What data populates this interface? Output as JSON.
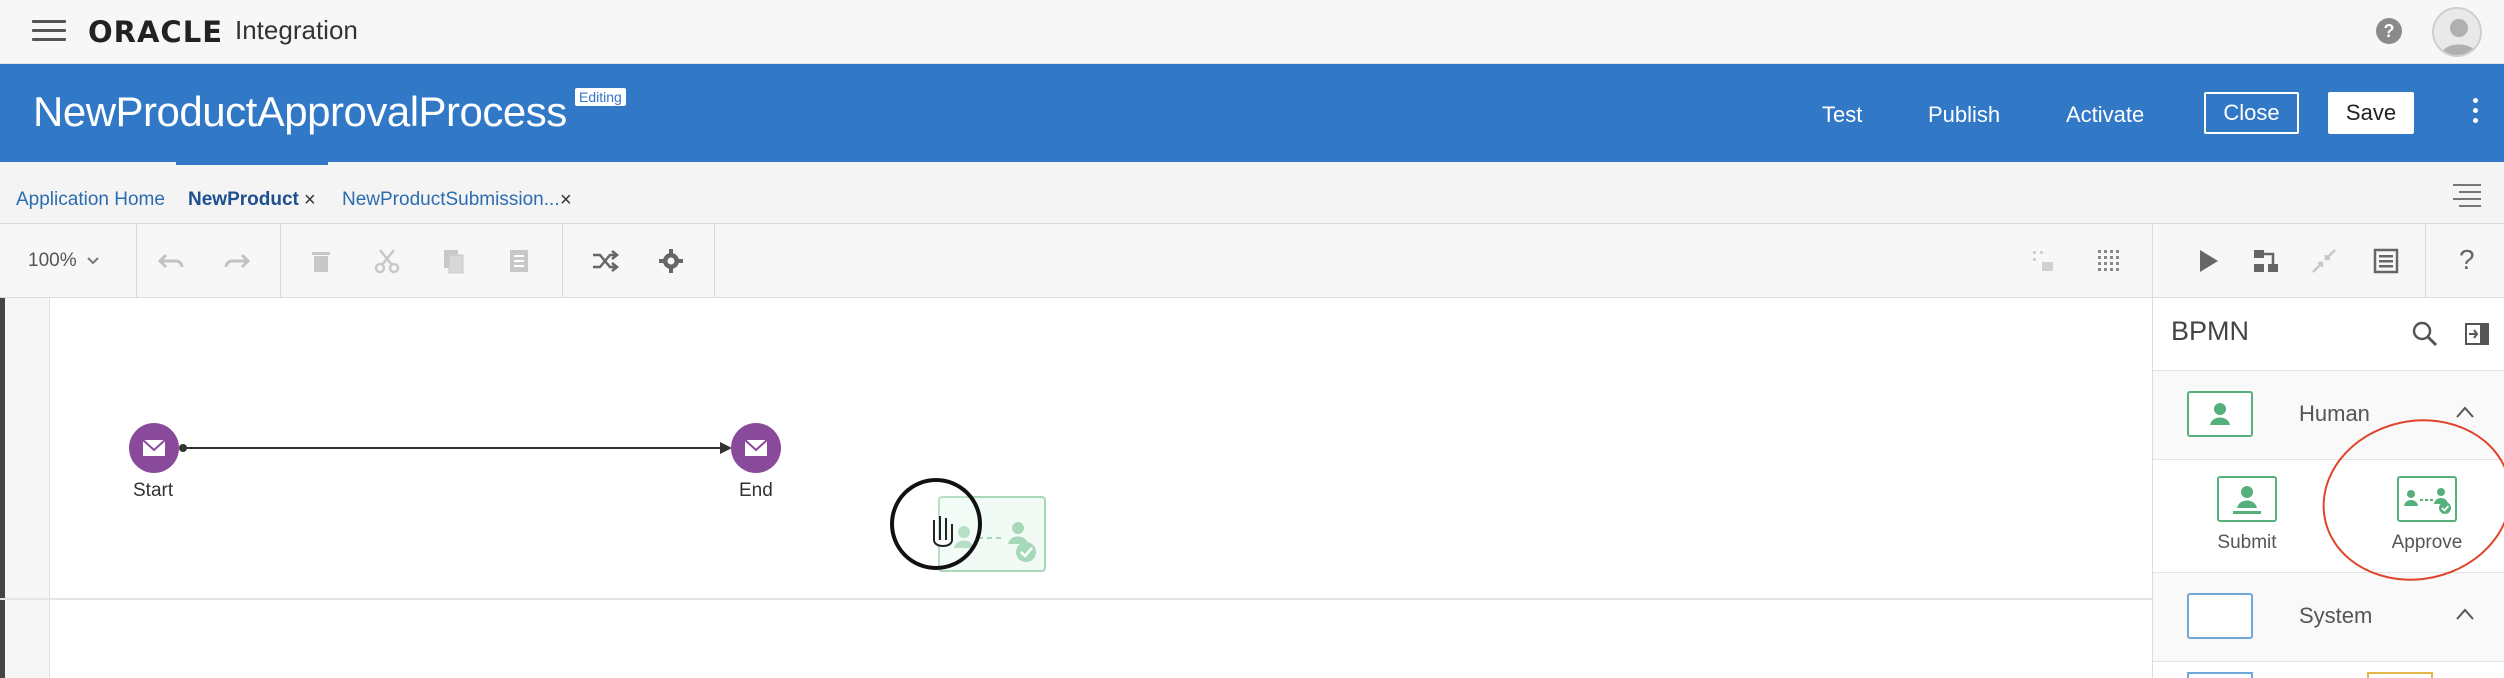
{
  "app": {
    "brand": "ORACLE",
    "product": "Integration"
  },
  "header": {
    "process_title": "NewProductApprovalProcess",
    "status_badge": "Editing",
    "links": [
      "Test",
      "Publish",
      "Activate"
    ],
    "close_label": "Close",
    "save_label": "Save"
  },
  "tabs": [
    {
      "label": "Application Home",
      "active": false,
      "closable": false
    },
    {
      "label": "NewProduct",
      "active": true,
      "closable": true
    },
    {
      "label": "NewProductSubmission...",
      "active": false,
      "closable": true
    }
  ],
  "toolbar": {
    "zoom": "100%"
  },
  "canvas": {
    "start_label": "Start",
    "end_label": "End"
  },
  "palette": {
    "title": "BPMN",
    "sections": [
      {
        "label": "Human",
        "items": [
          {
            "label": "Submit"
          },
          {
            "label": "Approve"
          }
        ]
      },
      {
        "label": "System",
        "items": []
      }
    ]
  },
  "colors": {
    "header_blue": "#3178c6",
    "event_purple": "#8a4a9c",
    "task_green": "#56b07b",
    "annotation_red": "#e0442b"
  }
}
